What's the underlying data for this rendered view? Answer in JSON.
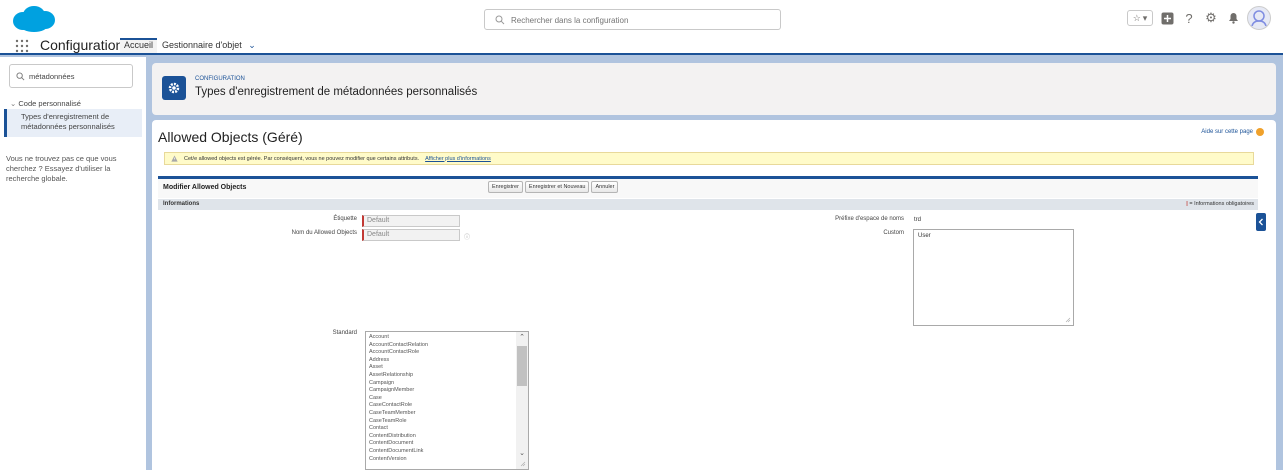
{
  "header": {
    "search_placeholder": "Rechercher dans la configuration"
  },
  "nav": {
    "app_name": "Configuration",
    "tabs": [
      {
        "label": "Accueil"
      },
      {
        "label": "Gestionnaire d'objet"
      }
    ]
  },
  "sidebar": {
    "search_value": "métadonnées",
    "tree_parent": "Code personnalisé",
    "tree_child_line1": "Types d'enregistrement de",
    "tree_child_line2": "métadonnées personnalisés",
    "help_text": "Vous ne trouvez pas ce que vous cherchez ? Essayez d'utiliser la recherche globale."
  },
  "setup": {
    "eyebrow": "CONFIGURATION",
    "title": "Types d'enregistrement de métadonnées personnalisés"
  },
  "main": {
    "title": "Allowed Objects (Géré)",
    "help_link": "Aide sur cette page",
    "banner_text": "Cet/e allowed objects est gérée. Par conséquent, vous ne pouvez modifier que certains attributs.",
    "banner_link": "Afficher plus d'informations",
    "edit_title": "Modifier Allowed Objects",
    "buttons": {
      "save": "Enregistrer",
      "save_new": "Enregistrer et Nouveau",
      "cancel": "Annuler"
    },
    "section_title": "Informations",
    "required_legend": "= Informations obligatoires",
    "fields": {
      "label_label": "Étiquette",
      "label_value": "Default",
      "name_label": "Nom du Allowed Objects",
      "name_value": "Default",
      "ns_label": "Préfixe d'espace de noms",
      "ns_value": "trd",
      "custom_label": "Custom",
      "custom_value": "User",
      "standard_label": "Standard"
    },
    "standard_options": [
      "Account",
      "AccountContactRelation",
      "AccountContactRole",
      "Address",
      "Asset",
      "AssetRelationship",
      "Campaign",
      "CampaignMember",
      "Case",
      "CaseContactRole",
      "CaseTeamMember",
      "CaseTeamRole",
      "Contact",
      "ContentDistribution",
      "ContentDocument",
      "ContentDocumentLink",
      "ContentVersion"
    ]
  },
  "colors": {
    "brand": "#1b5297",
    "required": "#c23934",
    "banner": "#fffbc9"
  }
}
